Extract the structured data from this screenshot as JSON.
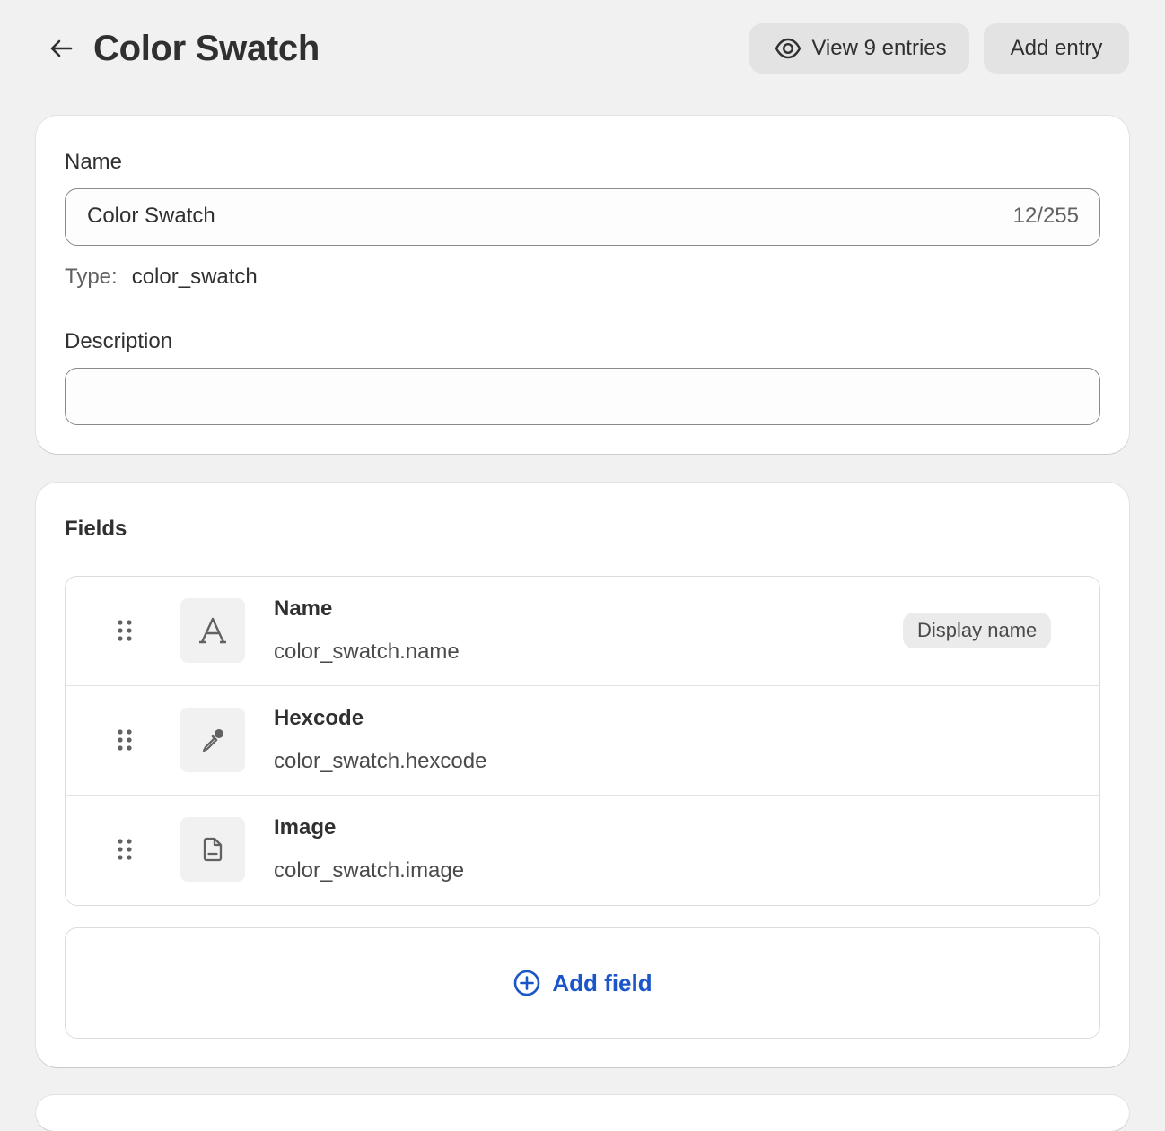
{
  "header": {
    "title": "Color Swatch",
    "view_entries_label": "View 9 entries",
    "add_entry_label": "Add entry"
  },
  "details": {
    "name_label": "Name",
    "name_value": "Color Swatch",
    "name_count": "12/255",
    "type_label": "Type:",
    "type_value": "color_swatch",
    "description_label": "Description",
    "description_value": ""
  },
  "fields": {
    "title": "Fields",
    "items": [
      {
        "name": "Name",
        "key": "color_swatch.name",
        "icon": "text-type-icon",
        "badge": "Display name"
      },
      {
        "name": "Hexcode",
        "key": "color_swatch.hexcode",
        "icon": "color-picker-icon"
      },
      {
        "name": "Image",
        "key": "color_swatch.image",
        "icon": "file-icon"
      }
    ],
    "add_label": "Add field"
  },
  "colors": {
    "accent": "#1a55c9",
    "background": "#f1f1f1",
    "button": "#e3e3e3"
  }
}
